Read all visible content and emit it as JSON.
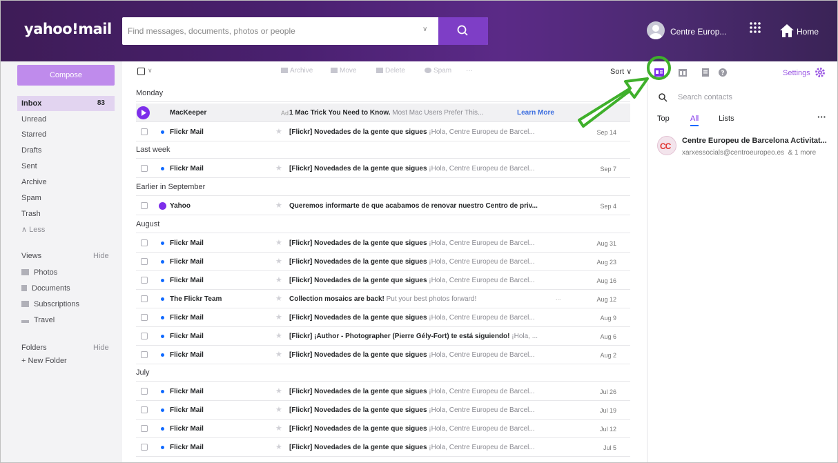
{
  "header": {
    "logo": "yahoo!mail",
    "search_placeholder": "Find messages, documents, photos or people",
    "account_name": "Centre Europ...",
    "home_label": "Home"
  },
  "sidebar": {
    "compose_label": "Compose",
    "folders": [
      {
        "label": "Inbox",
        "count": "83"
      },
      {
        "label": "Unread"
      },
      {
        "label": "Starred"
      },
      {
        "label": "Drafts"
      },
      {
        "label": "Sent"
      },
      {
        "label": "Archive"
      },
      {
        "label": "Spam"
      },
      {
        "label": "Trash"
      },
      {
        "label": "∧ Less"
      }
    ],
    "views_label": "Views",
    "views_hide": "Hide",
    "views": [
      {
        "label": "Photos",
        "icon": "photos-icon"
      },
      {
        "label": "Documents",
        "icon": "documents-icon"
      },
      {
        "label": "Subscriptions",
        "icon": "subscriptions-icon"
      },
      {
        "label": "Travel",
        "icon": "travel-icon"
      }
    ],
    "folders_label": "Folders",
    "folders_hide": "Hide",
    "new_folder": "+ New Folder"
  },
  "toolbar": {
    "archive": "Archive",
    "move": "Move",
    "delete": "Delete",
    "spam": "Spam",
    "more": "···",
    "sort": "Sort ∨"
  },
  "list": {
    "groups": {
      "monday": "Monday",
      "last_week": "Last week",
      "earlier_september": "Earlier in September",
      "august": "August",
      "july": "July"
    },
    "ad": {
      "sender": "MacKeeper",
      "tag": "Ad",
      "subject": "1 Mac Trick You Need to Know.",
      "preview": "Most Mac Users Prefer This...",
      "cta": "Learn More"
    },
    "messages": [
      {
        "sender": "Flickr Mail",
        "subject": "[Flickr] Novedades de la gente que sigues",
        "preview": "¡Hola, Centre Europeu de Barcel...",
        "date": "Sep 14"
      },
      {
        "sender": "Flickr Mail",
        "subject": "[Flickr] Novedades de la gente que sigues",
        "preview": "¡Hola, Centre Europeu de Barcel...",
        "date": "Sep 7"
      },
      {
        "sender": "Yahoo",
        "subject": "Queremos informarte de que acabamos de renovar nuestro Centro de priv...",
        "preview": "",
        "date": "Sep 4"
      },
      {
        "sender": "Flickr Mail",
        "subject": "[Flickr] Novedades de la gente que sigues",
        "preview": "¡Hola, Centre Europeu de Barcel...",
        "date": "Aug 31"
      },
      {
        "sender": "Flickr Mail",
        "subject": "[Flickr] Novedades de la gente que sigues",
        "preview": "¡Hola, Centre Europeu de Barcel...",
        "date": "Aug 23"
      },
      {
        "sender": "Flickr Mail",
        "subject": "[Flickr] Novedades de la gente que sigues",
        "preview": "¡Hola, Centre Europeu de Barcel...",
        "date": "Aug 16"
      },
      {
        "sender": "The Flickr Team",
        "subject": "Collection mosaics are back!",
        "preview": "Put your best photos forward!",
        "extra": "...",
        "date": "Aug 12"
      },
      {
        "sender": "Flickr Mail",
        "subject": "[Flickr] Novedades de la gente que sigues",
        "preview": "¡Hola, Centre Europeu de Barcel...",
        "date": "Aug 9"
      },
      {
        "sender": "Flickr Mail",
        "subject": "[Flickr] ¡Author - Photographer (Pierre Gély-Fort) te está siguiendo!",
        "preview": "¡Hola, ...",
        "date": "Aug 6"
      },
      {
        "sender": "Flickr Mail",
        "subject": "[Flickr] Novedades de la gente que sigues",
        "preview": "¡Hola, Centre Europeu de Barcel...",
        "date": "Aug 2"
      },
      {
        "sender": "Flickr Mail",
        "subject": "[Flickr] Novedades de la gente que sigues",
        "preview": "¡Hola, Centre Europeu de Barcel...",
        "date": "Jul 26"
      },
      {
        "sender": "Flickr Mail",
        "subject": "[Flickr] Novedades de la gente que sigues",
        "preview": "¡Hola, Centre Europeu de Barcel...",
        "date": "Jul 19"
      },
      {
        "sender": "Flickr Mail",
        "subject": "[Flickr] Novedades de la gente que sigues",
        "preview": "¡Hola, Centre Europeu de Barcel...",
        "date": "Jul 12"
      },
      {
        "sender": "Flickr Mail",
        "subject": "[Flickr] Novedades de la gente que sigues",
        "preview": "¡Hola, Centre Europeu de Barcel...",
        "date": "Jul 5"
      }
    ]
  },
  "contacts": {
    "settings": "Settings",
    "search_placeholder": "Search contacts",
    "tabs": {
      "top": "Top",
      "all": "All",
      "lists": "Lists"
    },
    "more": "···",
    "contact": {
      "initials": "CC",
      "name": "Centre Europeu de Barcelona Activitat...",
      "email": "xarxessocials@centroeuropeo.es",
      "count": "& 1 more"
    }
  },
  "colors": {
    "header_gradient": "#4a2070",
    "accent": "#7d2eea",
    "compose": "#bf8bec",
    "unread_dot": "#0f69ff",
    "annotation": "#3fb02b"
  }
}
